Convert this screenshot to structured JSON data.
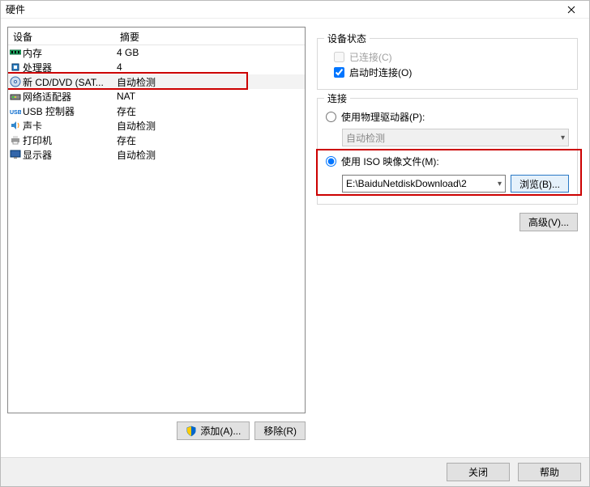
{
  "window": {
    "title": "硬件"
  },
  "list": {
    "header_device": "设备",
    "header_summary": "摘要",
    "rows": [
      {
        "icon": "memory",
        "name": "内存",
        "summary": "4 GB"
      },
      {
        "icon": "cpu",
        "name": "处理器",
        "summary": "4"
      },
      {
        "icon": "disc",
        "name": "新 CD/DVD (SAT...",
        "summary": "自动检测",
        "selected": true
      },
      {
        "icon": "net",
        "name": "网络适配器",
        "summary": "NAT"
      },
      {
        "icon": "usb",
        "name": "USB 控制器",
        "summary": "存在"
      },
      {
        "icon": "sound",
        "name": "声卡",
        "summary": "自动检测"
      },
      {
        "icon": "printer",
        "name": "打印机",
        "summary": "存在"
      },
      {
        "icon": "display",
        "name": "显示器",
        "summary": "自动检测"
      }
    ]
  },
  "buttons": {
    "add": "添加(A)...",
    "remove": "移除(R)",
    "advanced": "高级(V)...",
    "browse": "浏览(B)...",
    "close": "关闭",
    "help": "帮助"
  },
  "status": {
    "legend": "设备状态",
    "connected_label": "已连接(C)",
    "connected_checked": false,
    "connected_enabled": false,
    "connect_on_power_label": "启动时连接(O)",
    "connect_on_power_checked": true
  },
  "connection": {
    "legend": "连接",
    "use_physical_label": "使用物理驱动器(P):",
    "physical_combo_value": "自动检测",
    "use_iso_label": "使用 ISO 映像文件(M):",
    "iso_path_value": "E:\\BaiduNetdiskDownload\\2",
    "selected": "iso"
  }
}
